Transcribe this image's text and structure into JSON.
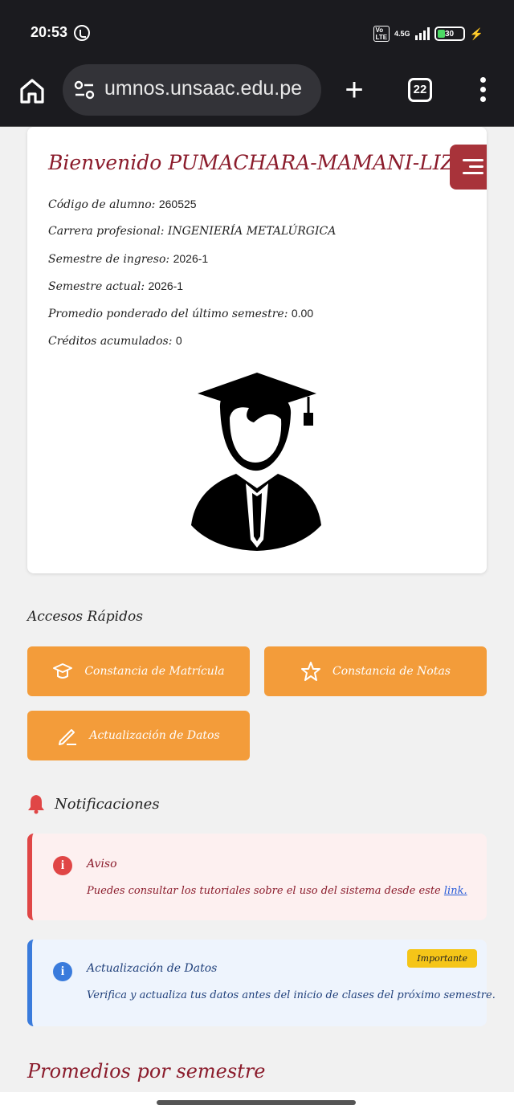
{
  "status_bar": {
    "time": "20:53",
    "volte": "VoLTE",
    "network": "4.5G",
    "battery": "30",
    "battery_level": 0.3
  },
  "browser": {
    "url": "umnos.unsaac.edu.pe",
    "tab_count": "22"
  },
  "welcome": "Bienvenido PUMACHARA-MAMANI-LIZARDO",
  "student_info": [
    {
      "label": "Código de alumno:",
      "value": "260525"
    },
    {
      "label": "Carrera profesional:",
      "value": "INGENIERÍA METALÚRGICA"
    },
    {
      "label": "Semestre de ingreso:",
      "value": "2026-1"
    },
    {
      "label": "Semestre actual:",
      "value": "2026-1"
    },
    {
      "label": "Promedio ponderado del último semestre:",
      "value": "0.00"
    },
    {
      "label": "Créditos acumulados:",
      "value": "0"
    }
  ],
  "quick_access": {
    "title": "Accesos Rápidos",
    "buttons": [
      {
        "label": "Constancia de Matrícula",
        "icon": "graduation-cap-icon"
      },
      {
        "label": "Constancia de Notas",
        "icon": "star-icon"
      },
      {
        "label": "Actualización de Datos",
        "icon": "pencil-icon"
      }
    ]
  },
  "notifications": {
    "title": "Notificaciones",
    "items": [
      {
        "type": "danger",
        "title": "Aviso",
        "body": "Puedes consultar los tutoriales sobre el uso del sistema desde este",
        "link": "link."
      },
      {
        "type": "info",
        "title": "Actualización de Datos",
        "badge": "Importante",
        "body": "Verifica y actualiza tus datos antes del inicio de clases del próximo semestre."
      }
    ]
  },
  "section_promedios": "Promedios por semestre",
  "colors": {
    "primary": "#8b1c2c",
    "menu_button": "#a8333a",
    "quick_button": "#f39c3a",
    "danger": "#e04646",
    "info": "#3a7bdc",
    "badge": "#f5c518"
  }
}
